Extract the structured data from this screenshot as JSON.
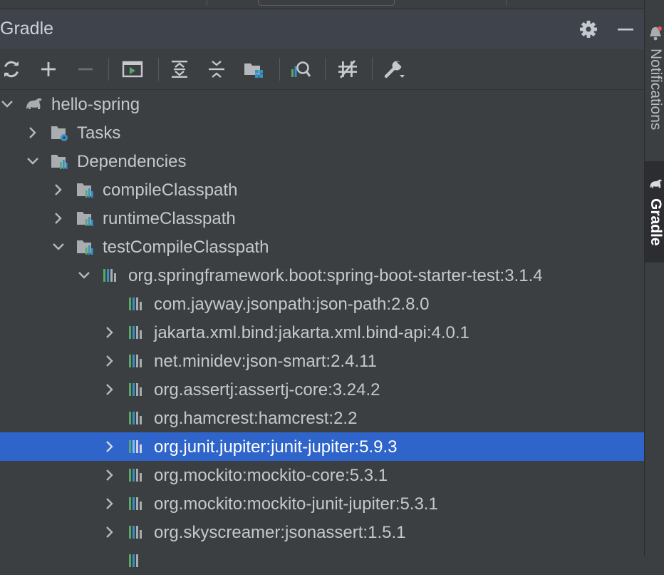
{
  "panel": {
    "title": "Gradle"
  },
  "sidebar": {
    "notifications_label": "Notifications",
    "gradle_label": "Gradle"
  },
  "colors": {
    "selection": "#2f65ca",
    "background": "#3c3f41",
    "accent_blue": "#3592c4",
    "accent_green": "#59a869"
  },
  "toolbar": [
    {
      "icon": "refresh-icon"
    },
    {
      "icon": "plus-icon"
    },
    {
      "icon": "minus-icon"
    },
    {
      "icon": "run-task-icon"
    },
    {
      "icon": "expand-all-icon"
    },
    {
      "icon": "collapse-all-icon"
    },
    {
      "icon": "group-modules-icon"
    },
    {
      "icon": "analyze-dependencies-icon"
    },
    {
      "icon": "toggle-offline-icon"
    },
    {
      "icon": "build-tool-settings-icon"
    }
  ],
  "tree": [
    {
      "label": "hello-spring"
    },
    {
      "label": "Tasks"
    },
    {
      "label": "Dependencies"
    },
    {
      "label": "compileClasspath"
    },
    {
      "label": "runtimeClasspath"
    },
    {
      "label": "testCompileClasspath"
    },
    {
      "label": "org.springframework.boot:spring-boot-starter-test:3.1.4"
    },
    {
      "label": "com.jayway.jsonpath:json-path:2.8.0"
    },
    {
      "label": "jakarta.xml.bind:jakarta.xml.bind-api:4.0.1"
    },
    {
      "label": "net.minidev:json-smart:2.4.11"
    },
    {
      "label": "org.assertj:assertj-core:3.24.2"
    },
    {
      "label": "org.hamcrest:hamcrest:2.2"
    },
    {
      "label": "org.junit.jupiter:junit-jupiter:5.9.3"
    },
    {
      "label": "org.mockito:mockito-core:5.3.1"
    },
    {
      "label": "org.mockito:mockito-junit-jupiter:5.3.1"
    },
    {
      "label": "org.skyscreamer:jsonassert:1.5.1"
    }
  ]
}
